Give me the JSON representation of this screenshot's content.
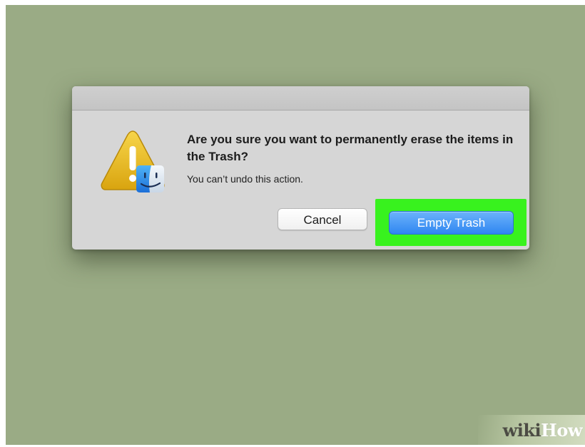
{
  "dialog": {
    "message": "Are you sure you want to permanently erase the items in the Trash?",
    "informative_text": "You can’t undo this action.",
    "icon": "caution-finder-icon",
    "buttons": {
      "cancel_label": "Cancel",
      "confirm_label": "Empty Trash"
    }
  },
  "watermark": {
    "part1": "wiki",
    "part2": "How"
  },
  "colors": {
    "desktop": "#9aab85",
    "dialog_bg": "#d6d6d6",
    "highlight": "#38f21e",
    "primary_button": "#2f86f1"
  }
}
